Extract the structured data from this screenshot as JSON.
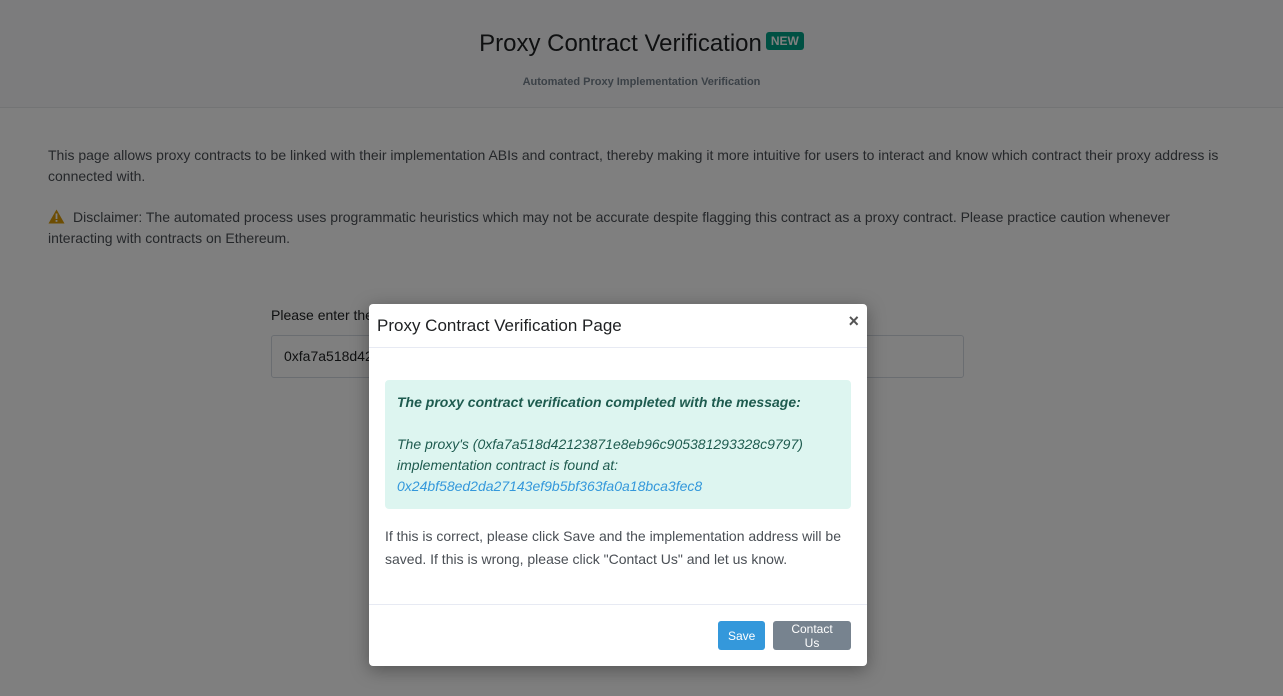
{
  "header": {
    "title": "Proxy Contract Verification",
    "badge": "NEW",
    "subtitle": "Automated Proxy Implementation Verification"
  },
  "content": {
    "intro": "This page allows proxy contracts to be linked with their implementation ABIs and contract, thereby making it more intuitive for users to interact and know which contract their proxy address is connected with.",
    "disclaimer": "Disclaimer: The automated process uses programmatic heuristics which may not be accurate despite flagging this contract as a proxy contract. Please practice caution whenever interacting with contracts on Ethereum.",
    "address_label": "Please enter the",
    "address_value": "0xfa7a518d42"
  },
  "modal": {
    "title": "Proxy Contract Verification Page",
    "close": "×",
    "alert_heading": "The proxy contract verification completed with the message:",
    "alert_body": "The proxy's (0xfa7a518d42123871e8eb96c905381293328c9797) implementation contract is found at:",
    "implementation_address": "0x24bf58ed2da27143ef9b5bf363fa0a18bca3fec8",
    "message": "If this is correct, please click Save and the implementation address will be saved. If this is wrong, please click \"Contact Us\" and let us know.",
    "save_label": "Save",
    "contact_label": "Contact Us"
  },
  "colors": {
    "accent": "#3498db",
    "badge": "#00a186",
    "alert_bg": "#ddf5f0",
    "warning": "#db9a04"
  }
}
